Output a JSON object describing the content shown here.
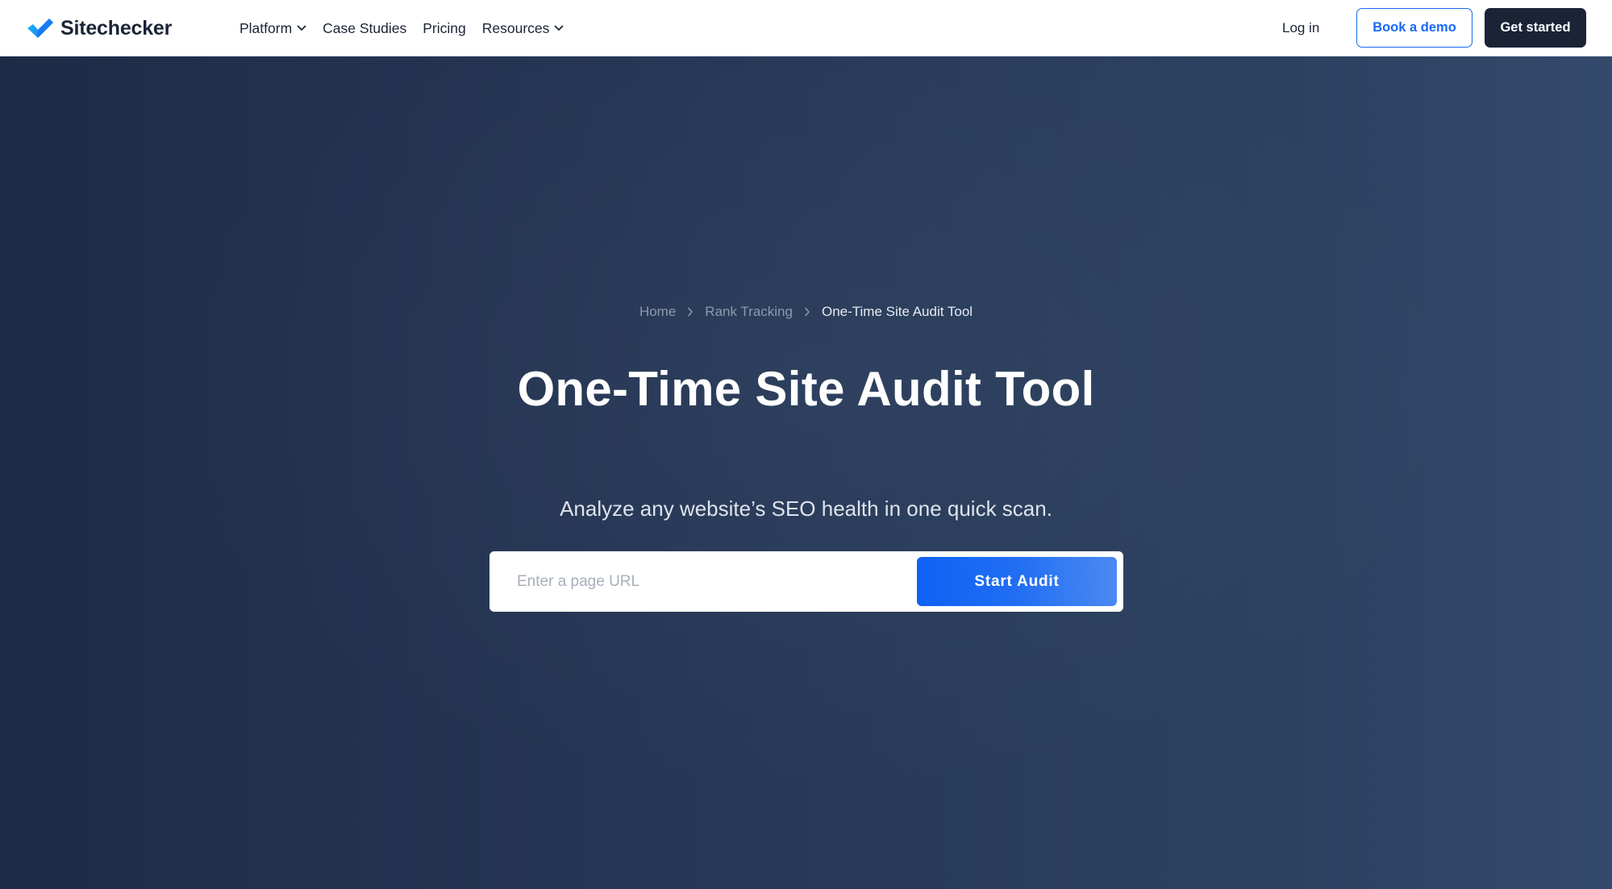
{
  "brand": {
    "name": "Sitechecker",
    "logo_icon": "check-mark-logo-icon",
    "accent_color": "#1668f4",
    "dark_color": "#1b2436"
  },
  "nav": {
    "items": [
      {
        "label": "Platform",
        "has_dropdown": true
      },
      {
        "label": "Case Studies",
        "has_dropdown": false
      },
      {
        "label": "Pricing",
        "has_dropdown": false
      },
      {
        "label": "Resources",
        "has_dropdown": true
      }
    ],
    "login_label": "Log in",
    "demo_label": "Book a demo",
    "get_started_label": "Get started"
  },
  "breadcrumb": {
    "items": [
      "Home",
      "Rank Tracking"
    ],
    "current": "One-Time Site Audit Tool"
  },
  "hero": {
    "title": "One-Time Site Audit Tool",
    "subtitle": "Analyze any website’s SEO health in one quick scan.",
    "search_placeholder": "Enter a page URL",
    "search_value": "",
    "button_label": "Start Audit"
  }
}
